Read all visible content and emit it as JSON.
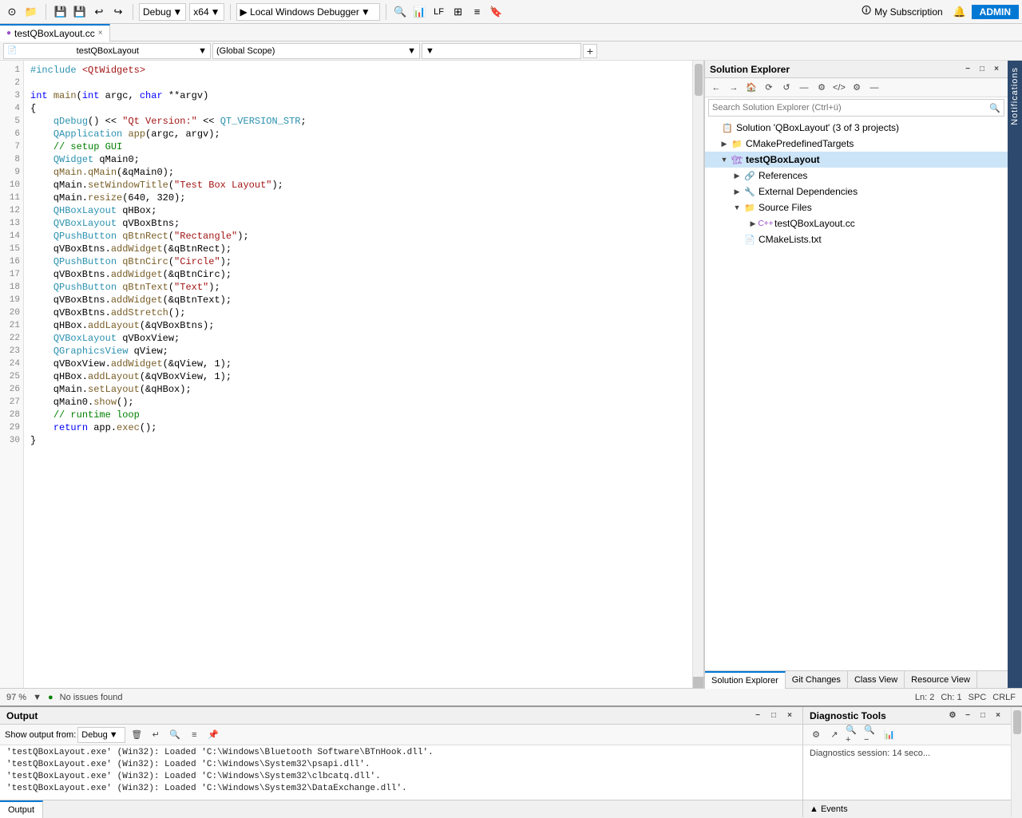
{
  "toolbar": {
    "debug_label": "Debug",
    "arch_label": "x64",
    "run_label": "▶ Local Windows Debugger",
    "subscription_label": "My Subscription",
    "admin_label": "ADMIN"
  },
  "tabs": {
    "file_tab": "testQBoxLayout.cc"
  },
  "editor": {
    "context_selector": "testQBoxLayout",
    "scope_selector": "(Global Scope)",
    "code_lines": [
      "#include <QtWidgets>",
      "",
      "int main(int argc, char **argv)",
      "{",
      "    qDebug() << \"Qt Version:\" << QT_VERSION_STR;",
      "    QApplication app(argc, argv);",
      "    // setup GUI",
      "    QWidget qMain0;",
      "    qMain.qMain(&qMain0);",
      "    qMain.setWindowTitle(\"Test Box Layout\");",
      "    qMain.resize(640, 320);",
      "    QHBoxLayout qHBox;",
      "    QVBoxLayout qVBoxBtns;",
      "    QPushButton qBtnRect(\"Rectangle\");",
      "    qVBoxBtns.addWidget(&qBtnRect);",
      "    QPushButton qBtnCirc(\"Circle\");",
      "    qVBoxBtns.addWidget(&qBtnCirc);",
      "    QPushButton qBtnText(\"Text\");",
      "    qVBoxBtns.addWidget(&qBtnText);",
      "    qVBoxBtns.addStretch();",
      "    qHBox.addLayout(&qVBoxBtns);",
      "    QVBoxLayout qVBoxView;",
      "    QGraphicsView qView;",
      "    qVBoxView.addWidget(&qView, 1);",
      "    qHBox.addLayout(&qVBoxView, 1);",
      "    qMain.setLayout(&qHBox);",
      "    qMain0.show();",
      "    // runtime loop",
      "    return app.exec();",
      "}"
    ]
  },
  "solution_explorer": {
    "title": "Solution Explorer",
    "search_placeholder": "Search Solution Explorer (Ctrl+ü)",
    "solution_label": "Solution 'QBoxLayout' (3 of 3 projects)",
    "items": [
      {
        "label": "CMakePredefinedTargets",
        "depth": 1,
        "expanded": false,
        "icon": "folder"
      },
      {
        "label": "testQBoxLayout",
        "depth": 1,
        "expanded": true,
        "icon": "project",
        "selected": true
      },
      {
        "label": "References",
        "depth": 2,
        "expanded": false,
        "icon": "ref"
      },
      {
        "label": "External Dependencies",
        "depth": 2,
        "expanded": false,
        "icon": "dep"
      },
      {
        "label": "Source Files",
        "depth": 2,
        "expanded": true,
        "icon": "folder"
      },
      {
        "label": "testQBoxLayout.cc",
        "depth": 3,
        "expanded": false,
        "icon": "cpp"
      },
      {
        "label": "CMakeLists.txt",
        "depth": 2,
        "expanded": false,
        "icon": "cmake"
      }
    ],
    "bottom_tabs": [
      "Solution Explorer",
      "Git Changes",
      "Class View",
      "Resource View"
    ],
    "active_bottom_tab": "Solution Explorer"
  },
  "status_bar": {
    "zoom": "97 %",
    "no_issues": "No issues found",
    "ln": "Ln: 2",
    "ch": "Ch: 1",
    "spc": "SPC",
    "crlf": "CRLF"
  },
  "output_panel": {
    "title": "Output",
    "source_label": "Show output from:",
    "source_value": "Debug",
    "lines": [
      "'testQBoxLayout.exe' (Win32): Loaded 'C:\\Windows\\Bluetooth Software\\BTnHook.dll'.",
      "'testQBoxLayout.exe' (Win32): Loaded 'C:\\Windows\\System32\\psapi.dll'.",
      "'testQBoxLayout.exe' (Win32): Loaded 'C:\\Windows\\System32\\clbcatq.dll'.",
      "'testQBoxLayout.exe' (Win32): Loaded 'C:\\Windows\\System32\\DataExchange.dll'."
    ]
  },
  "diag_panel": {
    "title": "Diagnostic Tools",
    "session_text": "Diagnostics session: 14 seco...",
    "events_label": "▲ Events"
  },
  "bottom_tabs": [
    "Output"
  ],
  "notifications": "Notifications"
}
